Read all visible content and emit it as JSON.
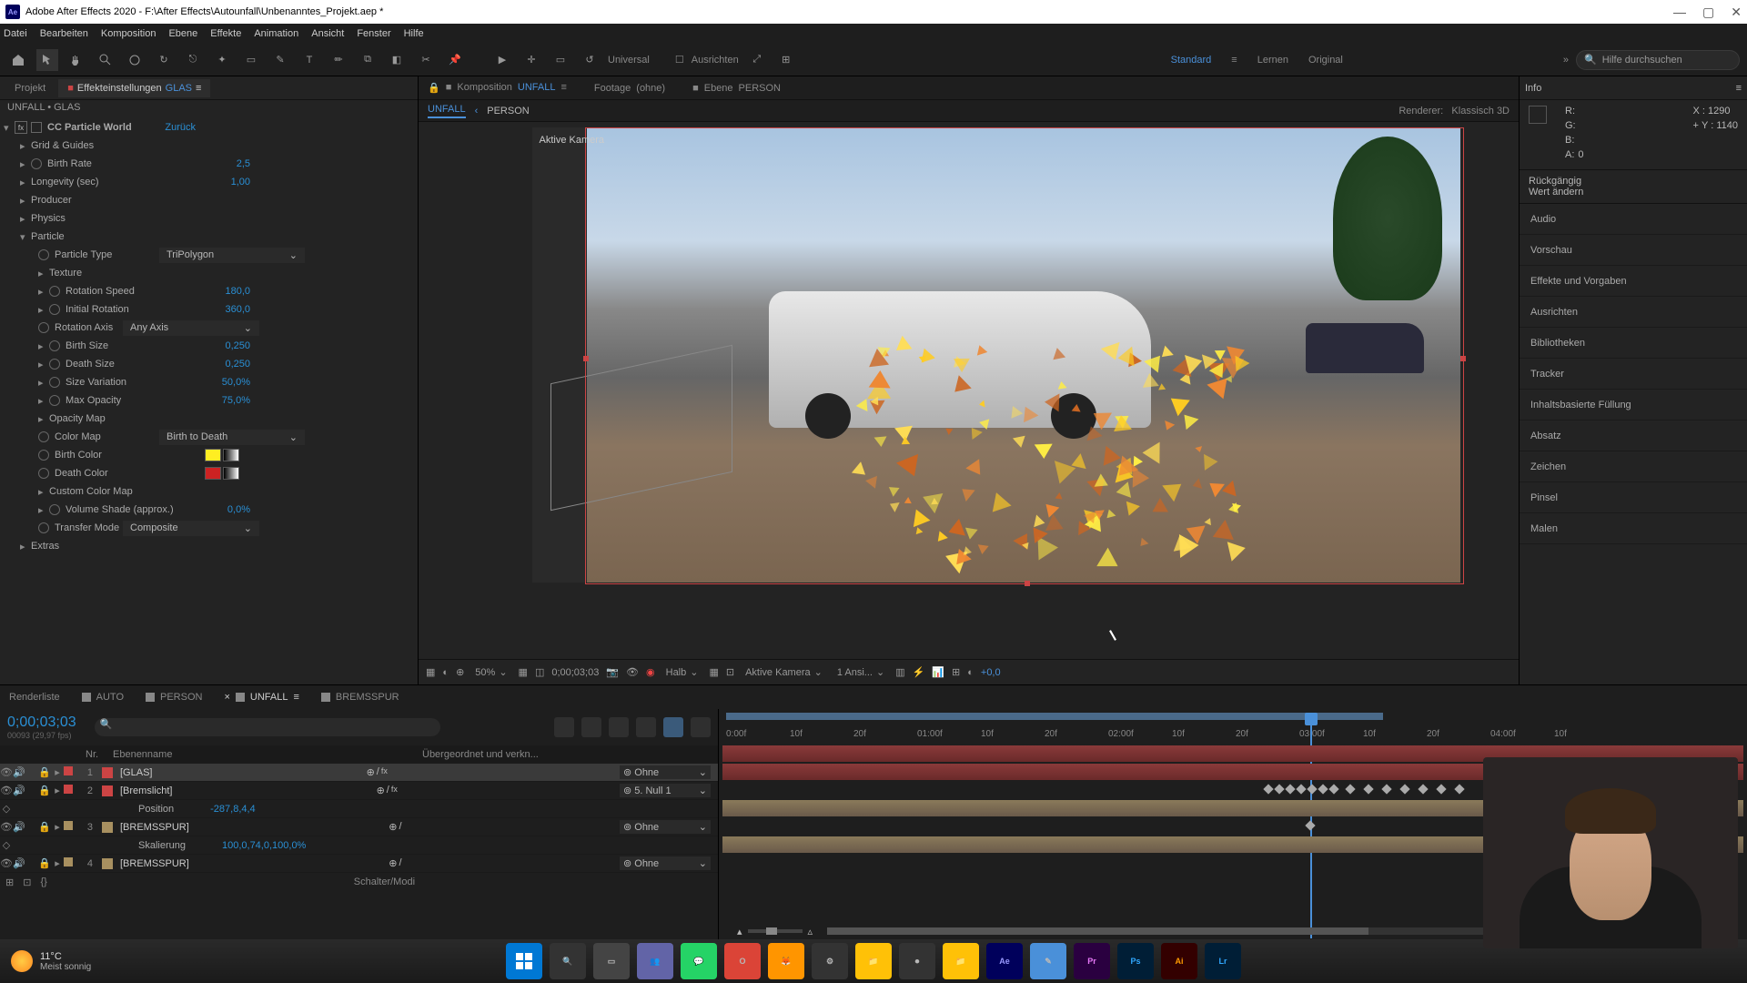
{
  "app": {
    "title": "Adobe After Effects 2020 - F:\\After Effects\\Autounfall\\Unbenanntes_Projekt.aep *"
  },
  "menu": [
    "Datei",
    "Bearbeiten",
    "Komposition",
    "Ebene",
    "Effekte",
    "Animation",
    "Ansicht",
    "Fenster",
    "Hilfe"
  ],
  "toolbar": {
    "universal": "Universal",
    "ausrichten": "Ausrichten"
  },
  "workspaces": {
    "standard": "Standard",
    "lernen": "Lernen",
    "original": "Original"
  },
  "search": {
    "placeholder": "Hilfe durchsuchen"
  },
  "left": {
    "tab_project": "Projekt",
    "tab_effects": "Effekteinstellungen",
    "tab_effects_layer": "GLAS",
    "breadcrumb": "UNFALL • GLAS",
    "effect_name": "CC Particle World",
    "reset": "Zurück",
    "rows": {
      "grid": "Grid & Guides",
      "birthrate": "Birth Rate",
      "birthrate_v": "2,5",
      "longevity": "Longevity (sec)",
      "longevity_v": "1,00",
      "producer": "Producer",
      "physics": "Physics",
      "particle": "Particle",
      "ptype": "Particle Type",
      "ptype_v": "TriPolygon",
      "texture": "Texture",
      "rotspeed": "Rotation Speed",
      "rotspeed_v": "180,0",
      "initrot": "Initial Rotation",
      "initrot_v": "360,0",
      "rotaxis": "Rotation Axis",
      "rotaxis_v": "Any Axis",
      "bsize": "Birth Size",
      "bsize_v": "0,250",
      "dsize": "Death Size",
      "dsize_v": "0,250",
      "svar": "Size Variation",
      "svar_v": "50,0%",
      "maxop": "Max Opacity",
      "maxop_v": "75,0%",
      "opmap": "Opacity Map",
      "colmap": "Color Map",
      "colmap_v": "Birth to Death",
      "bcolor": "Birth Color",
      "dcolor": "Death Color",
      "ccmap": "Custom Color Map",
      "volshade": "Volume Shade (approx.)",
      "volshade_v": "0,0%",
      "tmode": "Transfer Mode",
      "tmode_v": "Composite",
      "extras": "Extras"
    }
  },
  "center": {
    "comp_label": "Komposition",
    "comp_name": "UNFALL",
    "footage_label": "Footage",
    "footage_name": "(ohne)",
    "layer_label": "Ebene",
    "layer_name": "PERSON",
    "crumb_unfall": "UNFALL",
    "crumb_person": "PERSON",
    "renderer_label": "Renderer:",
    "renderer_value": "Klassisch 3D",
    "active_camera": "Aktive Kamera",
    "zoom": "50%",
    "time": "0;00;03;03",
    "res": "Halb",
    "cam": "Aktive Kamera",
    "view": "1 Ansi...",
    "exposure": "+0,0"
  },
  "right": {
    "info": "Info",
    "r": "R:",
    "g": "G:",
    "b": "B:",
    "a": "A:",
    "a_v": "0",
    "x": "X : 1290",
    "y": "Y : 1140",
    "undo": "Rückgängig",
    "change": "Wert ändern",
    "panels": [
      "Audio",
      "Vorschau",
      "Effekte und Vorgaben",
      "Ausrichten",
      "Bibliotheken",
      "Tracker",
      "Inhaltsbasierte Füllung",
      "Absatz",
      "Zeichen",
      "Pinsel",
      "Malen"
    ]
  },
  "timeline": {
    "tab_render": "Renderliste",
    "tabs": [
      "AUTO",
      "PERSON",
      "UNFALL",
      "BREMSSPUR"
    ],
    "active_tab": "UNFALL",
    "timecode": "0;00;03;03",
    "subcode": "00093 (29,97 fps)",
    "col_num": "Nr.",
    "col_name": "Ebenenname",
    "col_parent": "Übergeordnet und verkn...",
    "layers": [
      {
        "n": "1",
        "name": "[GLAS]",
        "parent": "Ohne",
        "color": "#c44"
      },
      {
        "n": "2",
        "name": "[Bremslicht]",
        "parent": "5. Null 1",
        "color": "#c44"
      },
      {
        "n": "",
        "name": "Position",
        "prop": "-287,8,4,4",
        "color": ""
      },
      {
        "n": "3",
        "name": "[BREMSSPUR]",
        "parent": "Ohne",
        "color": "#a89060"
      },
      {
        "n": "",
        "name": "Skalierung",
        "prop": "100,0,74,0,100,0%",
        "color": ""
      },
      {
        "n": "4",
        "name": "[BREMSSPUR]",
        "parent": "Ohne",
        "color": "#a89060"
      }
    ],
    "schalter": "Schalter/Modi",
    "ticks": [
      "0:00f",
      "10f",
      "20f",
      "01:00f",
      "10f",
      "20f",
      "02:00f",
      "10f",
      "20f",
      "03:00f",
      "10f",
      "20f",
      "04:00f",
      "10f"
    ]
  },
  "taskbar": {
    "temp": "11°C",
    "cond": "Meist sonnig"
  }
}
